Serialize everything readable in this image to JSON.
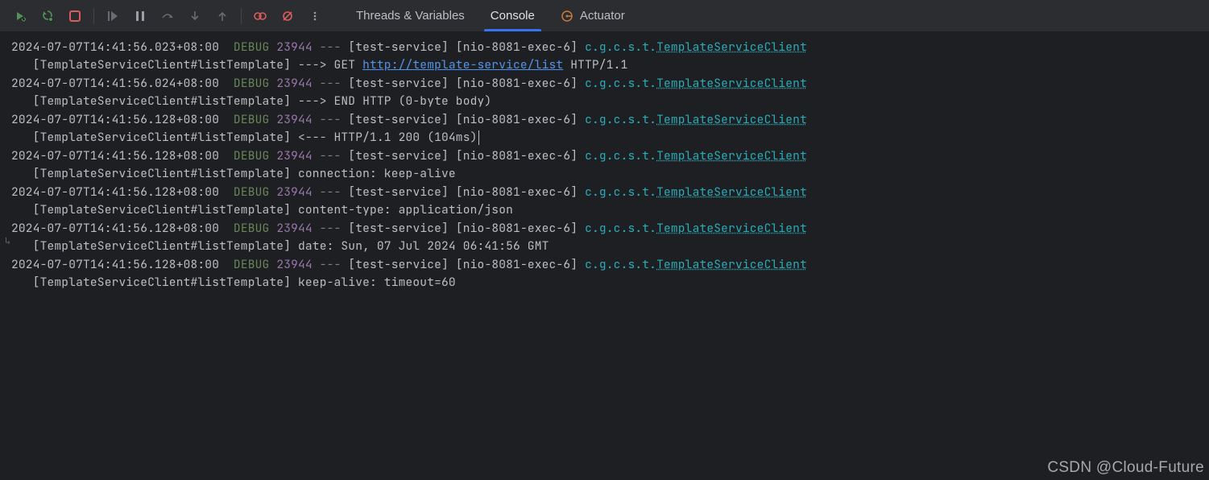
{
  "tabs": {
    "threads": "Threads & Variables",
    "console": "Console",
    "actuator": "Actuator"
  },
  "logs": [
    {
      "ts": "2024-07-07T14:41:56.023+08:00",
      "level": "DEBUG",
      "pid": "23944",
      "app": "[test-service]",
      "thread": "[nio-8081-exec-6]",
      "pkg": "c.g.c.s.t.",
      "cls": "TemplateServiceClient",
      "msg_prefix": "   [TemplateServiceClient#listTemplate] ---> GET ",
      "url": "http://template-service/list",
      "msg_suffix": " HTTP/1.1"
    },
    {
      "ts": "2024-07-07T14:41:56.024+08:00",
      "level": "DEBUG",
      "pid": "23944",
      "app": "[test-service]",
      "thread": "[nio-8081-exec-6]",
      "pkg": "c.g.c.s.t.",
      "cls": "TemplateServiceClient",
      "msg": "   [TemplateServiceClient#listTemplate] ---> END HTTP (0-byte body)"
    },
    {
      "ts": "2024-07-07T14:41:56.128+08:00",
      "level": "DEBUG",
      "pid": "23944",
      "app": "[test-service]",
      "thread": "[nio-8081-exec-6]",
      "pkg": "c.g.c.s.t.",
      "cls": "TemplateServiceClient",
      "msg": "   [TemplateServiceClient#listTemplate] <--- HTTP/1.1 200 (104ms)",
      "cursor": true
    },
    {
      "ts": "2024-07-07T14:41:56.128+08:00",
      "level": "DEBUG",
      "pid": "23944",
      "app": "[test-service]",
      "thread": "[nio-8081-exec-6]",
      "pkg": "c.g.c.s.t.",
      "cls": "TemplateServiceClient",
      "msg": "   [TemplateServiceClient#listTemplate] connection: keep-alive"
    },
    {
      "ts": "2024-07-07T14:41:56.128+08:00",
      "level": "DEBUG",
      "pid": "23944",
      "app": "[test-service]",
      "thread": "[nio-8081-exec-6]",
      "pkg": "c.g.c.s.t.",
      "cls": "TemplateServiceClient",
      "msg": "   [TemplateServiceClient#listTemplate] content-type: application/json"
    },
    {
      "ts": "2024-07-07T14:41:56.128+08:00",
      "level": "DEBUG",
      "pid": "23944",
      "app": "[test-service]",
      "thread": "[nio-8081-exec-6]",
      "pkg": "c.g.c.s.t.",
      "cls": "TemplateServiceClient",
      "msg": "   [TemplateServiceClient#listTemplate] date: Sun, 07 Jul 2024 06:41:56 GMT"
    },
    {
      "ts": "2024-07-07T14:41:56.128+08:00",
      "level": "DEBUG",
      "pid": "23944",
      "app": "[test-service]",
      "thread": "[nio-8081-exec-6]",
      "pkg": "c.g.c.s.t.",
      "cls": "TemplateServiceClient",
      "msg": "   [TemplateServiceClient#listTemplate] keep-alive: timeout=60"
    }
  ],
  "watermark": "CSDN @Cloud-Future"
}
